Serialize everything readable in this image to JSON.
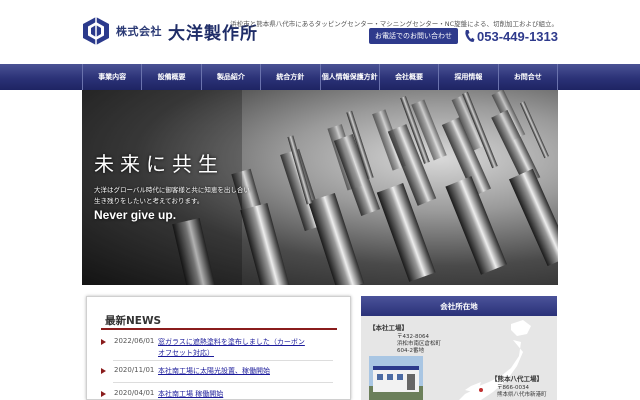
{
  "header": {
    "company_prefix": "株式会社",
    "company_name": "大洋製作所",
    "tagline": "浜松市と熊本県八代市にあるタッピングセンター・マシニングセンター・NC旋盤による、切削加工および組立。",
    "contact_button": "お電話でのお問い合わせ",
    "phone": "053-449-1313"
  },
  "nav": {
    "items": [
      "事業内容",
      "設備概要",
      "製品紹介",
      "統合方針",
      "個人情報保護方針",
      "会社概要",
      "採用情報",
      "お問合せ"
    ]
  },
  "hero": {
    "title": "未来に共生",
    "line1": "大洋はグローバル時代に御客様と共に知恵を出し合い",
    "line2": "生き残りをしたいと考えております。",
    "slogan": "Never give up."
  },
  "news": {
    "title": "最新NEWS",
    "items": [
      {
        "date": "2022/06/01",
        "text": "窓ガラスに遮熱塗料を塗布しました（カーボン",
        "text2": "オフセット対応）"
      },
      {
        "date": "2020/11/01",
        "text": "本社南工場に太陽光設置、稼働開始"
      },
      {
        "date": "2020/04/01",
        "text": "本社南工場 稼働開始"
      }
    ]
  },
  "location": {
    "title": "会社所在地",
    "main": {
      "label": "【本社工場】",
      "postal": "〒432-8064",
      "addr1": "浜松市南区倉松町",
      "addr2": "604-2番地"
    },
    "kumamoto": {
      "label": "【熊本八代工場】",
      "postal": "〒866-0034",
      "addr1": "熊本県八代市新港町"
    }
  },
  "colors": {
    "brand_navy": "#2b3277",
    "news_red": "#8a1c1c",
    "link_blue": "#1b1b9a"
  }
}
